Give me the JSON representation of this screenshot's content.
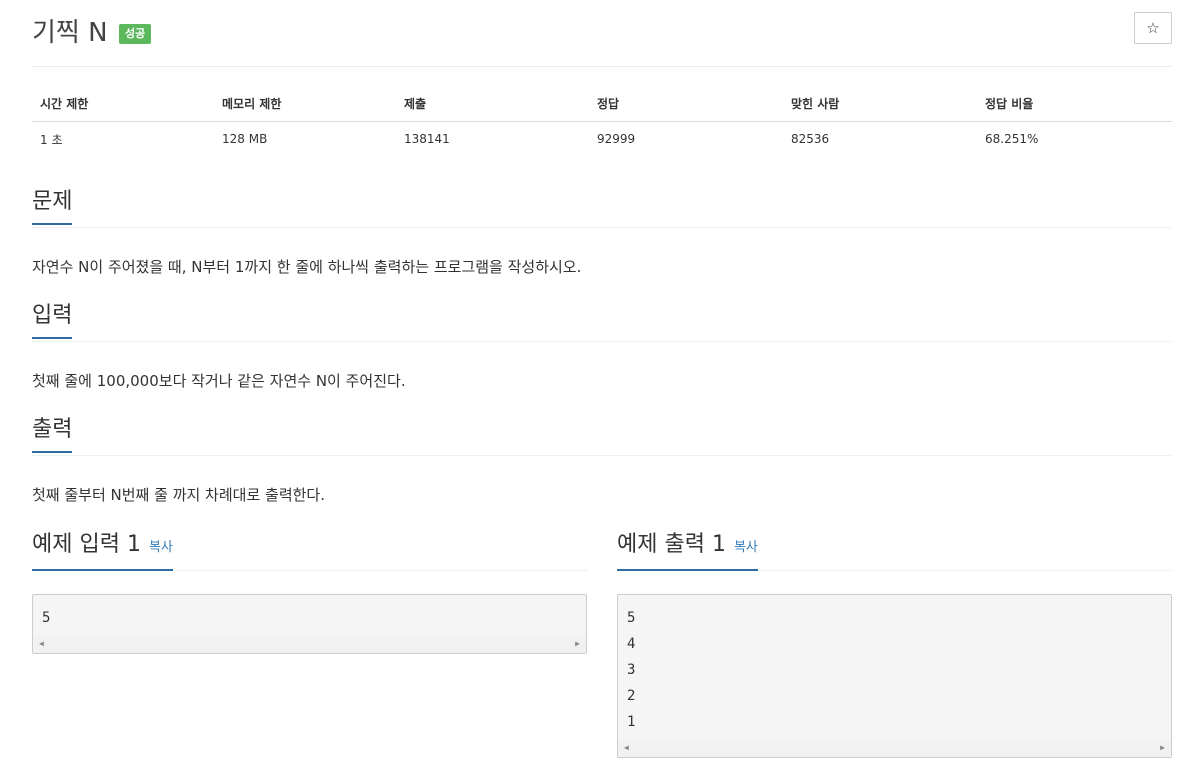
{
  "problem": {
    "title": "기찍 N",
    "badge": "성공",
    "star_icon": "☆"
  },
  "stats": {
    "headers": [
      "시간 제한",
      "메모리 제한",
      "제출",
      "정답",
      "맞힌 사람",
      "정답 비율"
    ],
    "values": [
      "1 초",
      "128 MB",
      "138141",
      "92999",
      "82536",
      "68.251%"
    ]
  },
  "sections": {
    "problem": {
      "heading": "문제",
      "text": "자연수 N이 주어졌을 때, N부터 1까지 한 줄에 하나씩 출력하는 프로그램을 작성하시오."
    },
    "input": {
      "heading": "입력",
      "text": "첫째 줄에 100,000보다 작거나 같은 자연수 N이 주어진다."
    },
    "output": {
      "heading": "출력",
      "text": "첫째 줄부터 N번째 줄 까지 차례대로 출력한다."
    }
  },
  "samples": {
    "input": {
      "heading": "예제 입력 1",
      "copy": "복사",
      "lines": [
        "5"
      ]
    },
    "output": {
      "heading": "예제 출력 1",
      "copy": "복사",
      "lines": [
        "5",
        "4",
        "3",
        "2",
        "1"
      ]
    }
  }
}
